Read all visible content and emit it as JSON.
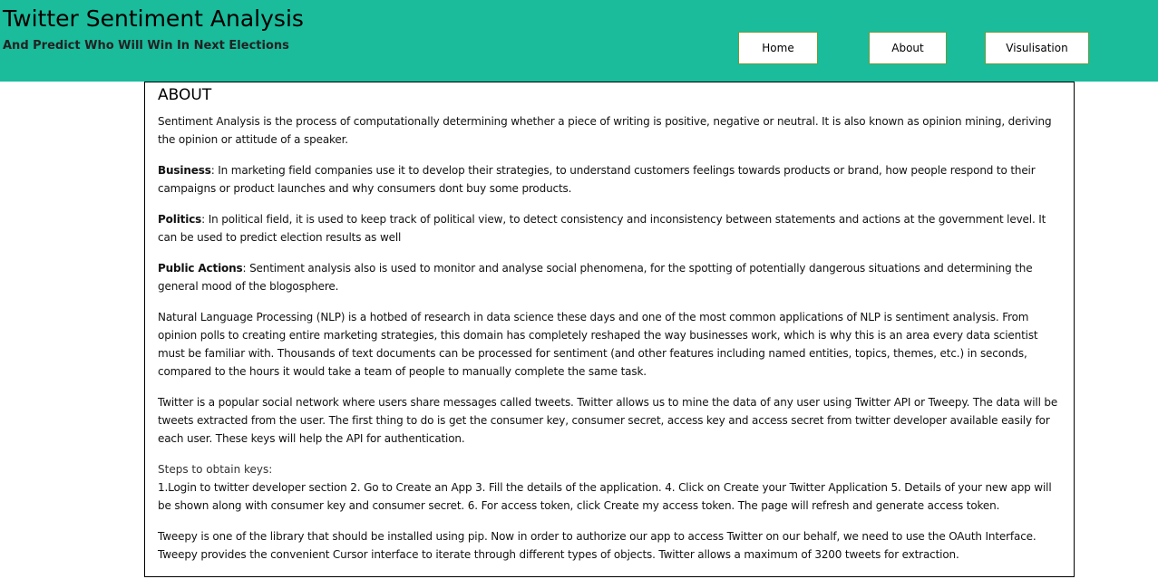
{
  "header": {
    "title": "Twitter Sentiment Analysis",
    "subtitle": "And Predict Who Will Win In Next Elections",
    "accent_color": "#1abc9c"
  },
  "nav": {
    "home_label": "Home",
    "about_label": "About",
    "visualisation_label": "Visulisation"
  },
  "about": {
    "heading": "ABOUT",
    "intro": "Sentiment Analysis is the process of computationally determining whether a piece of writing is positive, negative or neutral. It is also known as opinion mining, deriving the opinion or attitude of a speaker.",
    "business_label": "Business",
    "business_text": ": In marketing field companies use it to develop their strategies, to understand customers feelings towards products or brand, how people respond to their campaigns or product launches and why consumers dont buy some products.",
    "politics_label": "Politics",
    "politics_text": ": In political field, it is used to keep track of political view, to detect consistency and inconsistency between statements and actions at the government level. It can be used to predict election results as well",
    "public_label": "Public Actions",
    "public_text": ": Sentiment analysis also is used to monitor and analyse social phenomena, for the spotting of potentially dangerous situations and determining the general mood of the blogosphere.",
    "nlp": "Natural Language Processing (NLP) is a hotbed of research in data science these days and one of the most common applications of NLP is sentiment analysis. From opinion polls to creating entire marketing strategies, this domain has completely reshaped the way businesses work, which is why this is an area every data scientist must be familiar with. Thousands of text documents can be processed for sentiment (and other features including named entities, topics, themes, etc.) in seconds, compared to the hours it would take a team of people to manually complete the same task.",
    "twitter": "Twitter is a popular social network where users share messages called tweets. Twitter allows us to mine the data of any user using Twitter API or Tweepy. The data will be tweets extracted from the user. The first thing to do is get the consumer key, consumer secret, access key and access secret from twitter developer available easily for each user. These keys will help the API for authentication.",
    "steps_title": "Steps to obtain keys:",
    "steps": "1.Login to twitter developer section 2. Go to Create an App 3. Fill the details of the application. 4. Click on Create your Twitter Application 5. Details of your new app will be shown along with consumer key and consumer secret. 6. For access token, click Create my access token. The page will refresh and generate access token.",
    "tweepy": "Tweepy is one of the library that should be installed using pip. Now in order to authorize our app to access Twitter on our behalf, we need to use the OAuth Interface. Tweepy provides the convenient Cursor interface to iterate through different types of objects. Twitter allows a maximum of 3200 tweets for extraction."
  }
}
